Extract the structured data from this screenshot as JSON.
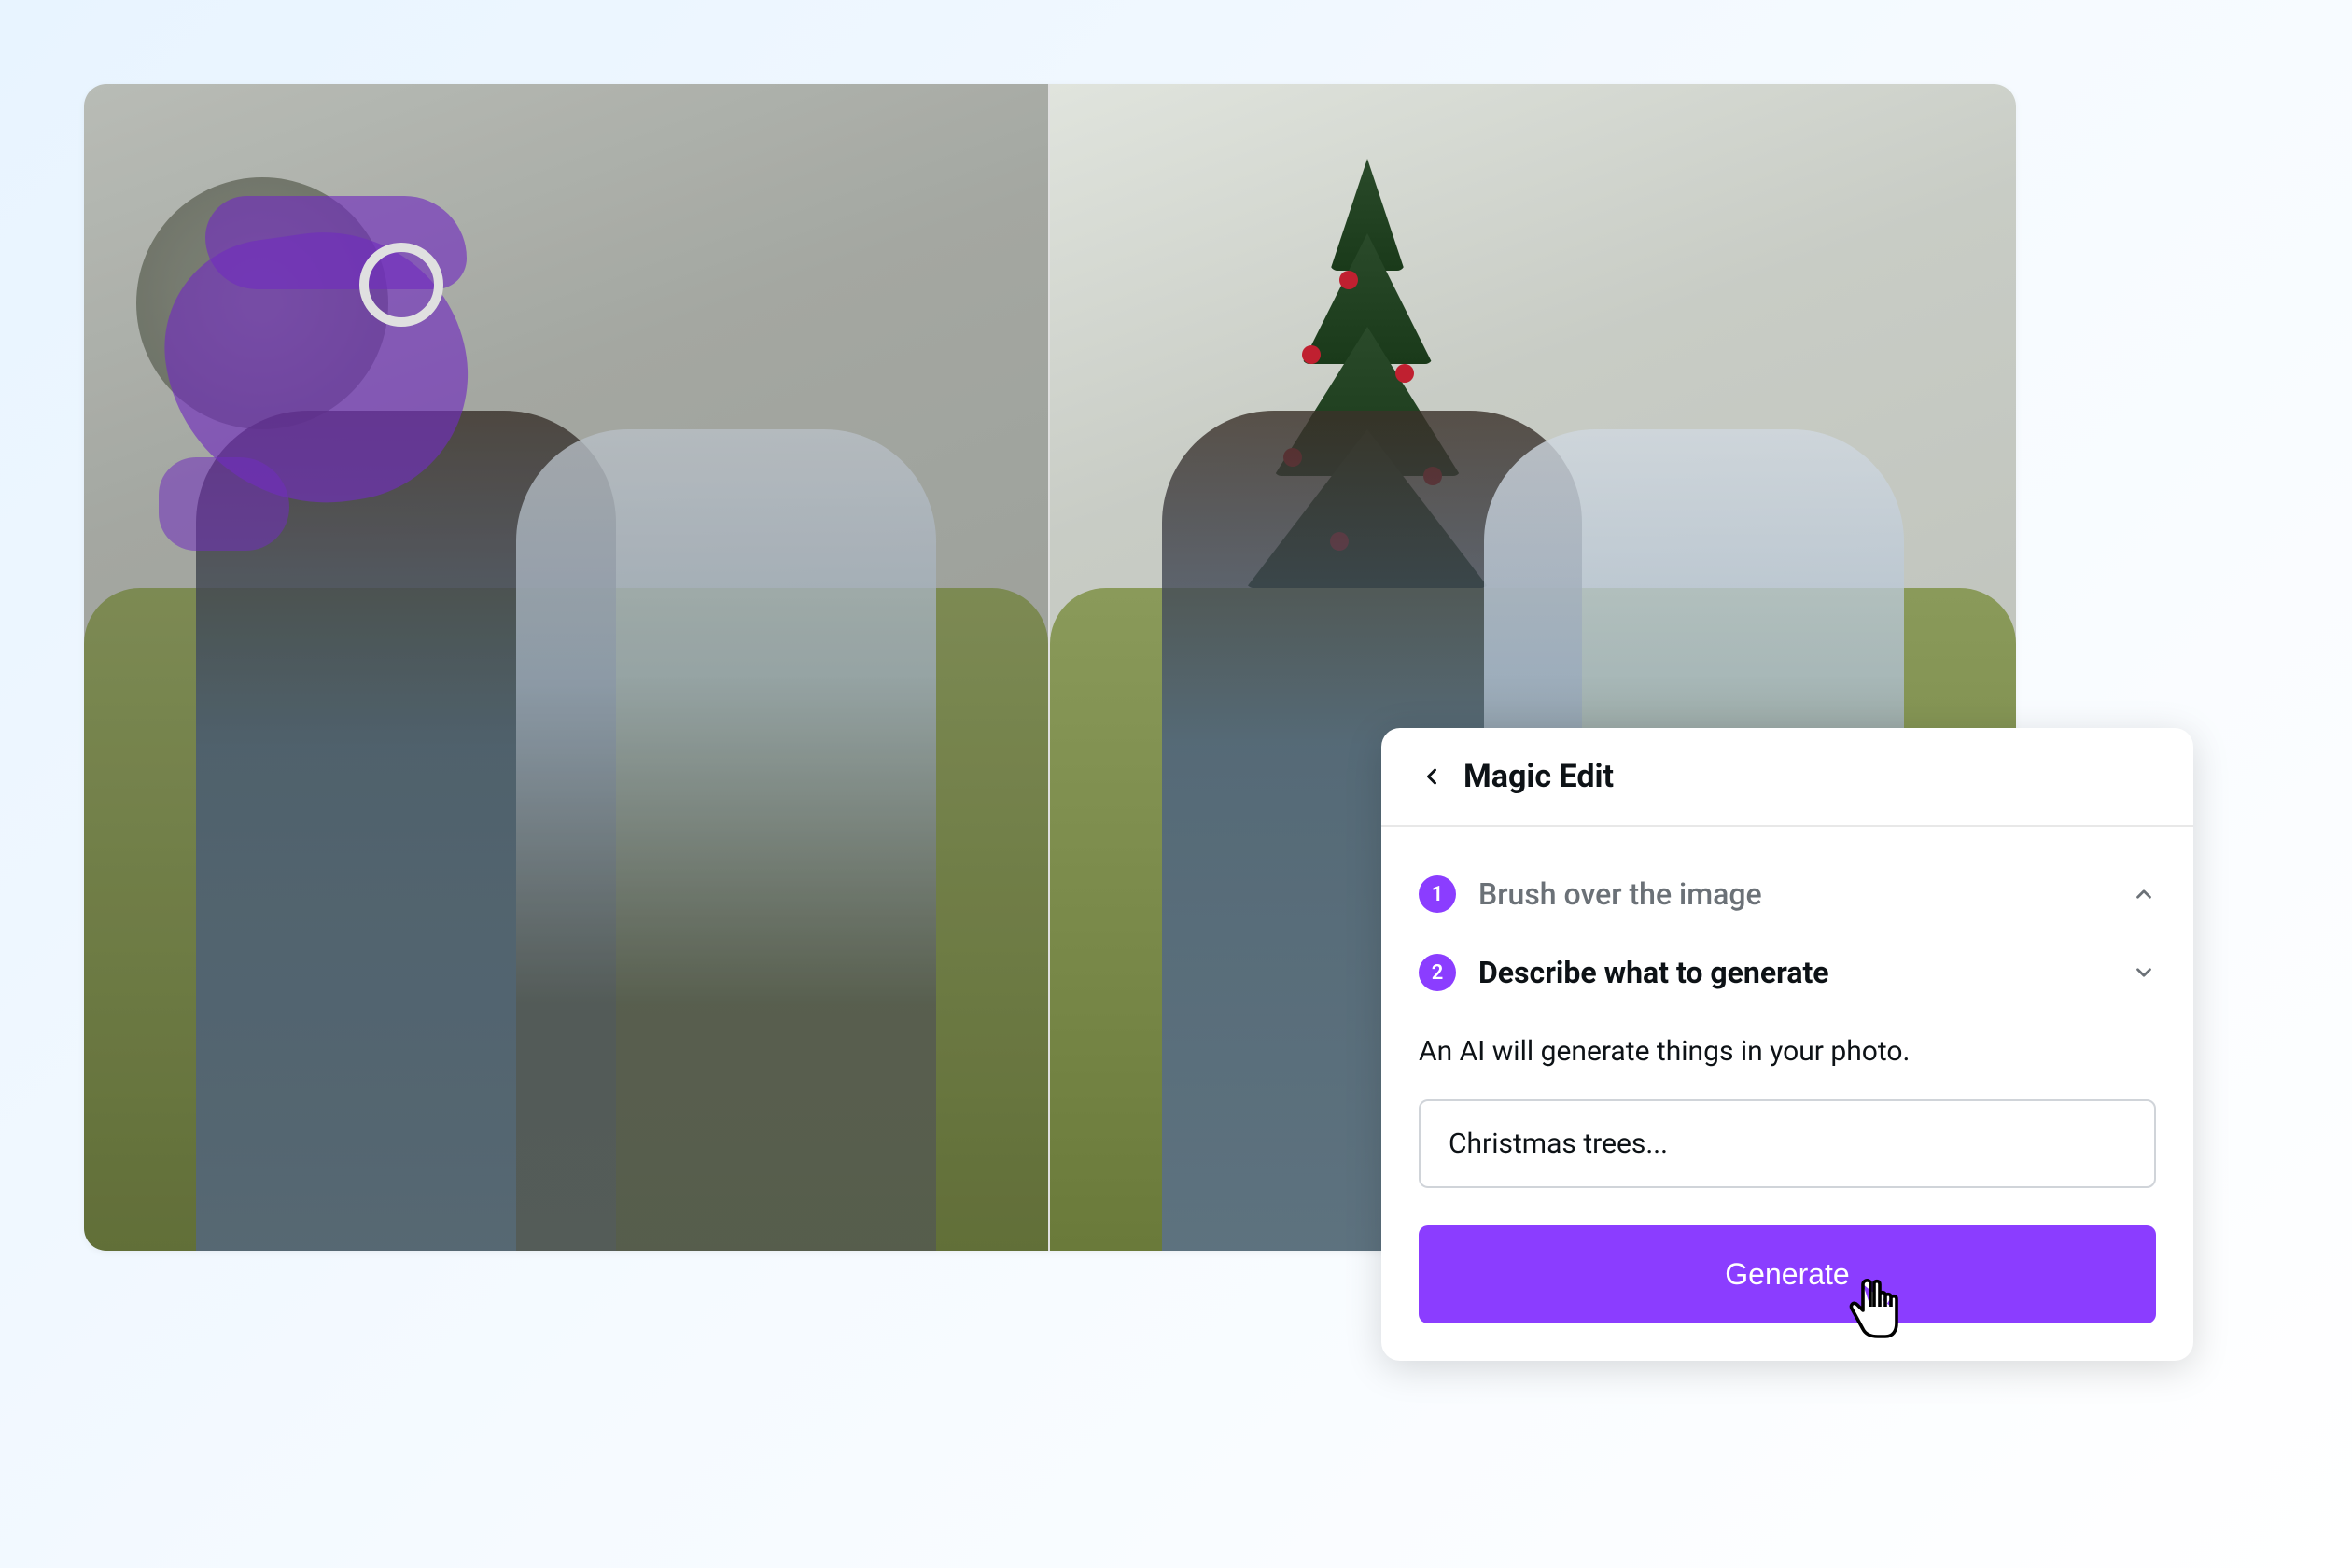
{
  "panel": {
    "title": "Magic Edit",
    "steps": [
      {
        "number": "1",
        "label": "Brush over the image",
        "active": false
      },
      {
        "number": "2",
        "label": "Describe what to generate",
        "active": true
      }
    ],
    "help_text": "An AI will generate things in your photo.",
    "prompt_value": "Christmas trees...",
    "generate_label": "Generate"
  },
  "colors": {
    "accent": "#8b3dff",
    "brush": "#7c2ed6"
  },
  "icons": {
    "back": "chevron-left",
    "collapse": "chevron-up",
    "expand": "chevron-down",
    "cursor": "pointer-hand"
  }
}
